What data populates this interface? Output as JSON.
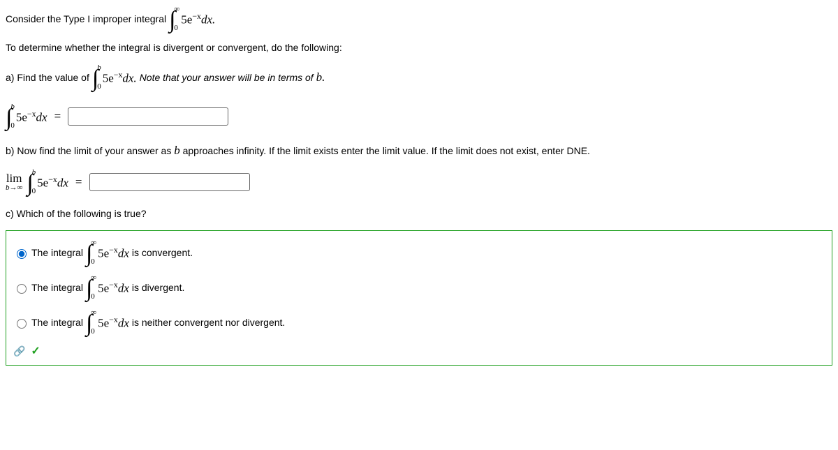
{
  "intro": {
    "prefix": "Consider the Type I improper integral",
    "integral": {
      "upper": "∞",
      "lower": "0",
      "body": "5e",
      "exp": "−x",
      "dx": "dx."
    }
  },
  "directive": "To determine whether the integral is divergent or convergent, do the following:",
  "partA": {
    "prefix": "a) Find the value of",
    "integral": {
      "upper": "b",
      "lower": "0",
      "body": "5e",
      "exp": "−x",
      "dx": "dx."
    },
    "note": "Note that your answer will be in terms of ",
    "note_var": "b."
  },
  "inputA": {
    "integral": {
      "upper": "b",
      "lower": "0",
      "body": "5e",
      "exp": "−x",
      "dx": "dx"
    },
    "value": ""
  },
  "partB": {
    "text": "b) Now find the limit of your answer as ",
    "var": "b",
    "text2": " approaches infinity. If the limit exists enter the limit value. If the limit does not exist, enter DNE."
  },
  "inputB": {
    "lim": "lim",
    "limsub": "b→∞",
    "integral": {
      "upper": "b",
      "lower": "0",
      "body": "5e",
      "exp": "−x",
      "dx": "dx"
    },
    "value": ""
  },
  "partC": {
    "prompt": "c) Which of the following is true?"
  },
  "options": [
    {
      "prefix": "The integral",
      "upper": "∞",
      "lower": "0",
      "body": "5e",
      "exp": "−x",
      "dx": "dx",
      "suffix": " is convergent.",
      "checked": true
    },
    {
      "prefix": "The integral",
      "upper": "∞",
      "lower": "0",
      "body": "5e",
      "exp": "−x",
      "dx": "dx",
      "suffix": " is divergent.",
      "checked": false
    },
    {
      "prefix": "The integral",
      "upper": "∞",
      "lower": "0",
      "body": "5e",
      "exp": "−x",
      "dx": "dx",
      "suffix": " is neither convergent nor divergent.",
      "checked": false
    }
  ],
  "eq": "="
}
